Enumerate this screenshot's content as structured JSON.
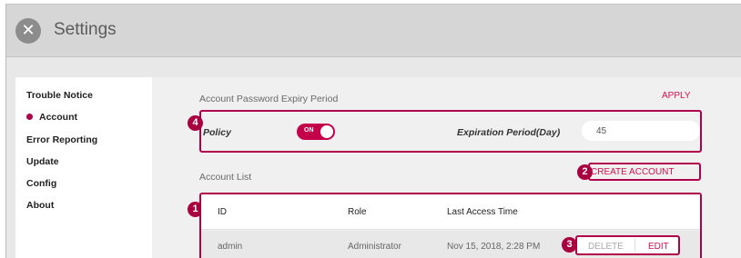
{
  "window": {
    "title": "Settings",
    "close_icon": "close-icon"
  },
  "sidebar": {
    "items": [
      {
        "label": "Trouble Notice",
        "active": false
      },
      {
        "label": "Account",
        "active": true
      },
      {
        "label": "Error Reporting",
        "active": false
      },
      {
        "label": "Update",
        "active": false
      },
      {
        "label": "Config",
        "active": false
      },
      {
        "label": "About",
        "active": false
      }
    ]
  },
  "expiry": {
    "section_title": "Account Password Expiry Period",
    "apply_label": "APPLY",
    "policy_label": "Policy",
    "policy_toggle": "ON",
    "expiration_label": "Expiration Period(Day)",
    "expiration_value": "45"
  },
  "accounts": {
    "section_title": "Account List",
    "create_label": "CREATE ACCOUNT",
    "columns": [
      "ID",
      "Role",
      "Last Access Time"
    ],
    "rows": [
      {
        "id": "admin",
        "role": "Administrator",
        "last_access": "Nov 15, 2018, 2:28 PM"
      }
    ],
    "delete_label": "DELETE",
    "edit_label": "EDIT"
  },
  "callouts": [
    "1",
    "2",
    "3",
    "4"
  ],
  "colors": {
    "accent": "#d1114f",
    "callout": "#a8003f",
    "header_bg": "#d6d6d6"
  }
}
